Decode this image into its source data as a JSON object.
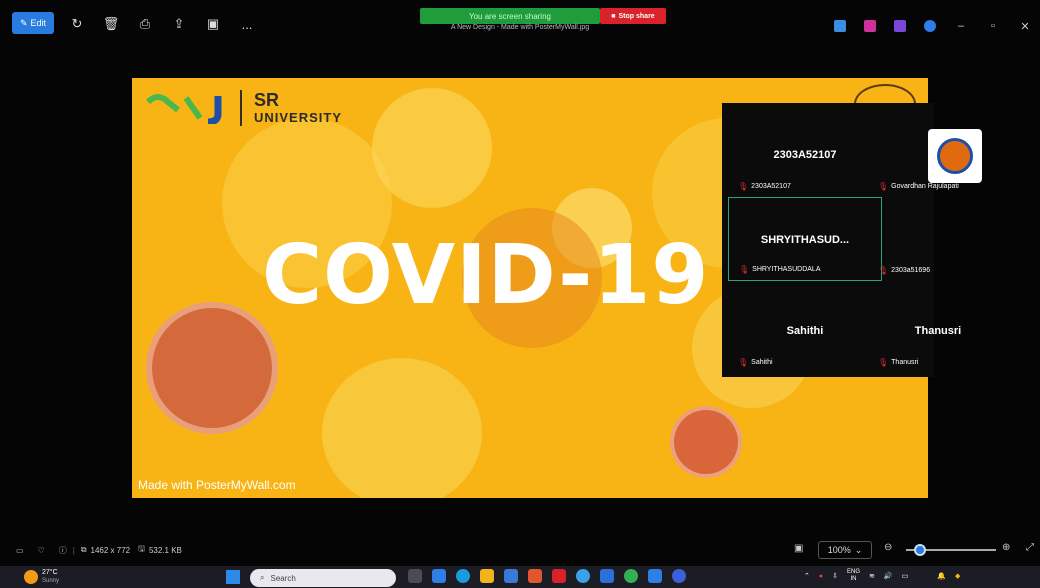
{
  "toolbar": {
    "edit_label": "Edit",
    "share_bar_text": "You are screen sharing",
    "stop_share_label": "Stop share",
    "file_title": "A New Design - Made with PosterMyWall.jpg",
    "more_label": "..."
  },
  "poster": {
    "org_name_line1": "SR",
    "org_name_line2": "UNIVERSITY",
    "headline": "COVID-19",
    "credit": "Made with PosterMyWall.com"
  },
  "participants": [
    {
      "display": "2303A52107",
      "label": "2303A52107",
      "active": false
    },
    {
      "display": "",
      "label": "Govardhan Rajulapati",
      "active": false
    },
    {
      "display": "SHRYITHASUD...",
      "label": "SHRYITHASUDDALA",
      "active": true
    },
    {
      "display": "",
      "label": "2303a51696",
      "active": false
    },
    {
      "display": "Sahithi",
      "label": "Sahithi",
      "active": false
    },
    {
      "display": "Thanusri",
      "label": "Thanusri",
      "active": false
    }
  ],
  "statusbar": {
    "dimensions": "1462 x 772",
    "filesize": "532.1 KB",
    "zoom": "100%"
  },
  "taskbar": {
    "temperature": "27°C",
    "weather": "Sunny",
    "search_placeholder": "Search",
    "lang_line1": "ENG",
    "lang_line2": "IN"
  },
  "colors": {
    "poster_bg": "#f7b414",
    "accent_blue": "#2a7be0",
    "share_green": "#1f9d3c",
    "stop_red": "#d8232a",
    "active_tile_border": "#2aa37a"
  }
}
